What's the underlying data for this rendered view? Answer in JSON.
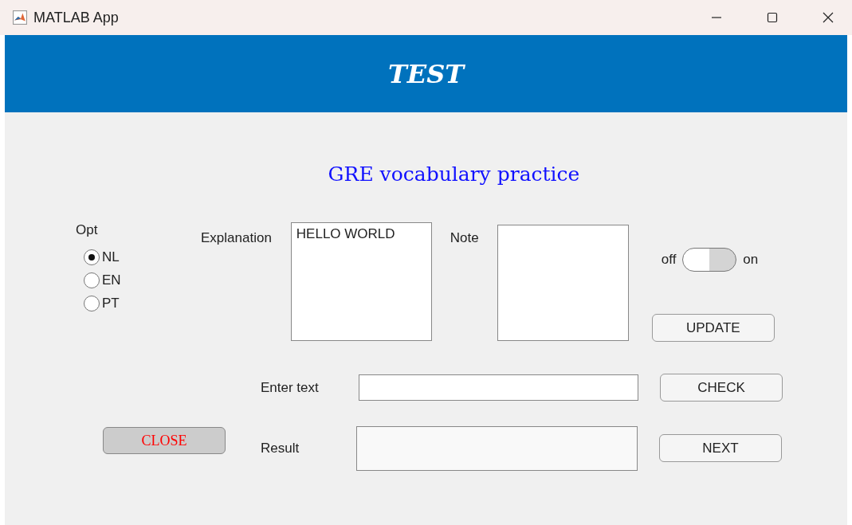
{
  "window": {
    "title": "MATLAB App"
  },
  "header": {
    "title": "TEST"
  },
  "heading": {
    "text": "GRE vocabulary practice"
  },
  "options": {
    "label": "Opt",
    "items": [
      {
        "label": "NL",
        "selected": true
      },
      {
        "label": "EN",
        "selected": false
      },
      {
        "label": "PT",
        "selected": false
      }
    ]
  },
  "explanation": {
    "label": "Explanation",
    "value": "HELLO WORLD"
  },
  "note": {
    "label": "Note"
  },
  "switch": {
    "off_label": "off",
    "on_label": "on",
    "on": false
  },
  "entry": {
    "label": "Enter text"
  },
  "result": {
    "label": "Result"
  },
  "buttons": {
    "update": "UPDATE",
    "check": "CHECK",
    "next": "NEXT",
    "close": "CLOSE"
  }
}
